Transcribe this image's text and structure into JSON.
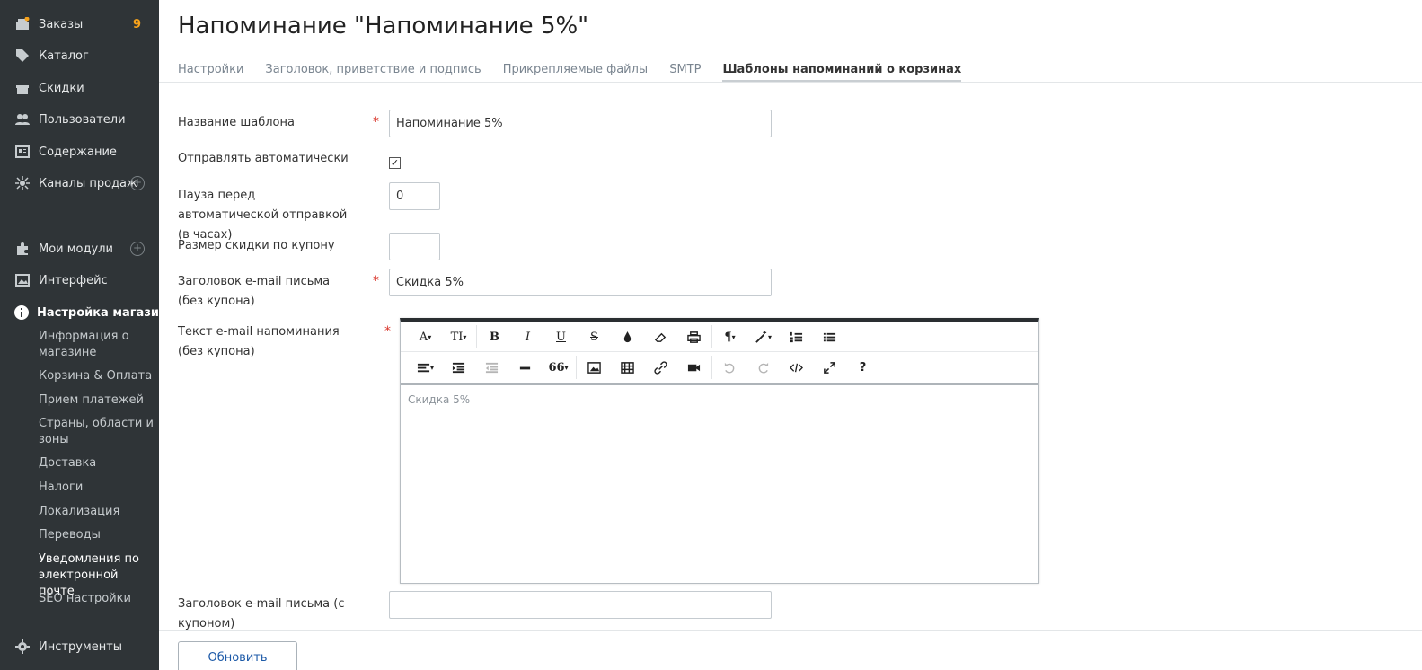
{
  "sidebar": {
    "items": [
      {
        "label": "Заказы",
        "icon": "orders-icon",
        "badge": "9"
      },
      {
        "label": "Каталог",
        "icon": "tags-icon"
      },
      {
        "label": "Скидки",
        "icon": "gift-icon"
      },
      {
        "label": "Пользователи",
        "icon": "users-icon"
      },
      {
        "label": "Содержание",
        "icon": "content-icon"
      },
      {
        "label": "Каналы продаж",
        "icon": "channels-icon",
        "plus": "+"
      },
      {
        "label": "Мои модули",
        "icon": "puzzle-icon",
        "plus": "+"
      },
      {
        "label": "Интерфейс",
        "icon": "image-icon"
      },
      {
        "label": "Настройка магазина",
        "icon": "info-icon"
      },
      {
        "label": "Инструменты",
        "icon": "gear-icon"
      }
    ],
    "subitems": [
      "Информация о магазине",
      "Корзина & Оплата",
      "Прием платежей",
      "Страны, области и зоны",
      "Доставка",
      "Налоги",
      "Локализация",
      "Переводы",
      "Уведомления по электронной почте",
      "SEO настройки"
    ]
  },
  "page": {
    "title": "Напоминание \"Напоминание 5%\"",
    "tabs": [
      "Настройки",
      "Заголовок, приветствие и подпись",
      "Прикрепляемые файлы",
      "SMTP",
      "Шаблоны напоминаний о корзинах"
    ]
  },
  "form": {
    "template_name_label": "Название шаблона",
    "template_name_value": "Напоминание 5%",
    "send_auto_label": "Отправлять автоматически",
    "send_auto_checked": "✓",
    "pause_label": "Пауза перед автоматической отправкой (в часах)",
    "pause_value": "0",
    "coupon_size_label": "Размер скидки по купону",
    "coupon_size_value": "",
    "subject_no_coupon_label": "Заголовок e-mail письма (без купона)",
    "subject_no_coupon_value": "Скидка 5%",
    "text_no_coupon_label": "Текст e-mail напоминания (без купона)",
    "text_no_coupon_value": "Скидка 5%",
    "subject_coupon_label": "Заголовок e-mail письма (с купоном)",
    "subject_coupon_value": "",
    "required_mark": "*"
  },
  "toolbar": {
    "font": "A",
    "font_size": "TI",
    "bold": "B",
    "italic": "I",
    "underline": "U",
    "strike": "S",
    "paragraph": "¶",
    "quote": "66",
    "help": "?"
  },
  "footer": {
    "update_label": "Обновить"
  },
  "colors": {
    "sidebar_bg": "#2f3437",
    "badge": "#f7a21b",
    "required": "#d9352b",
    "link_blue": "#1d5aa8"
  }
}
